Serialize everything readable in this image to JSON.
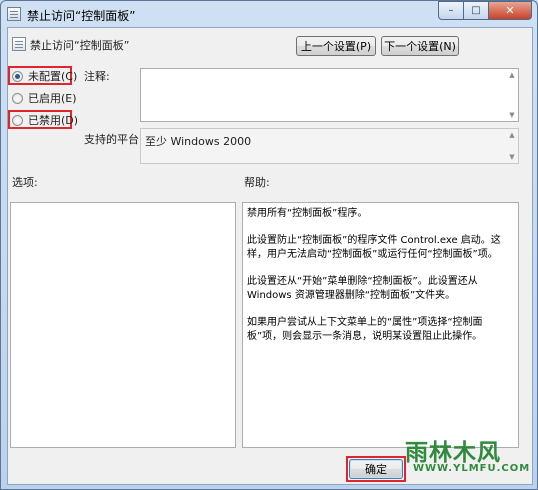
{
  "window": {
    "title": "禁止访问“控制面板”",
    "minimize_glyph": "–",
    "maximize_glyph": "□",
    "close_glyph": "✕"
  },
  "policy": {
    "name": "禁止访问“控制面板”",
    "icon": "policy-setting-icon"
  },
  "nav": {
    "prev_label": "上一个设置(P)",
    "next_label": "下一个设置(N)"
  },
  "radios": [
    {
      "label": "未配置(C)",
      "selected": true,
      "highlighted": true
    },
    {
      "label": "已启用(E)",
      "selected": false,
      "highlighted": false
    },
    {
      "label": "已禁用(D)",
      "selected": false,
      "highlighted": true
    }
  ],
  "fields": {
    "comment_label": "注释:",
    "comment_value": "",
    "platform_label": "支持的平台:",
    "platform_value": "至少 Windows 2000"
  },
  "sections": {
    "options_label": "选项:",
    "help_label": "帮助:"
  },
  "help": {
    "paragraphs": [
      "禁用所有“控制面板”程序。",
      "此设置防止“控制面板”的程序文件 Control.exe 启动。这样，用户无法启动“控制面板”或运行任何“控制面板”项。",
      "此设置还从“开始”菜单删除“控制面板”。此设置还从 Windows 资源管理器删除“控制面板”文件夹。",
      "如果用户尝试从上下文菜单上的“属性”项选择“控制面板”项，则会显示一条消息，说明某设置阻止此操作。"
    ]
  },
  "footer": {
    "ok_label": "确定"
  },
  "watermark": {
    "text": "雨林木风",
    "url": "WWW.YLMFU.COM"
  },
  "colors": {
    "highlight": "#e0262b",
    "watermark": "#2f8a3d"
  }
}
